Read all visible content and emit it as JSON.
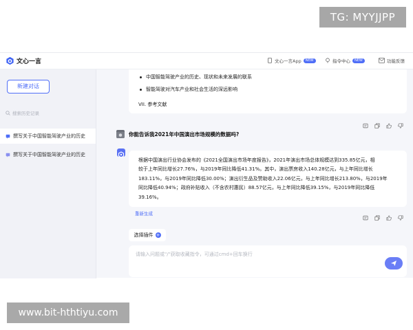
{
  "watermarks": {
    "top_right": "TG: MYYJJPP",
    "bottom_left": "www.bit-hthtiyu.com"
  },
  "header": {
    "app_name": "文心一言",
    "app_link": "文心一言App",
    "prompt_center": "指令中心",
    "feedback": "功能反馈",
    "badge_new": "NEW",
    "accent": "#4f6ef7"
  },
  "sidebar": {
    "new_chat": "新建对话",
    "search_placeholder": "搜索历史记录",
    "items": [
      {
        "label": "撰写关于中国智能驾驶产业的历史",
        "active": true
      },
      {
        "label": "撰写关于中国智能驾驶产业的历史",
        "active": false
      }
    ]
  },
  "conversation": {
    "prev_bullets": [
      "中国智能驾驶产业的历史、现状和未来发展的联系",
      "智能驾驶对汽车产业和社会生活的深远影响"
    ],
    "prev_section": "VII. 参考文献",
    "user_question": "你能告诉我2021年中国演出市场规模的数据吗?",
    "answer_lines": [
      "根据中国演出行业协会发布的《2021全国演出市场年度报告》，2021年演出市场总体规模达到335.85亿元，相",
      "较于上年同比增长27.76%，与2019年同比降低41.31%。其中，演出票房收入140.28亿元，与上年同比增长",
      "183.11%，与2019年同比降低30.00%；演出衍生品及赞助收入22.06亿元，与上年同比增长213.80%，与2019年",
      "同比降低40.94%；政府补贴收入（不含农村惠民）88.57亿元，与上年同比降低39.15%，与2019年同比降低",
      "39.16%。"
    ],
    "regenerate": "重新生成"
  },
  "composer": {
    "plugin_label": "选择插件",
    "placeholder": "请输入问题或\"/\"获取收藏指令，可通过cmd+回车换行",
    "value": ""
  }
}
